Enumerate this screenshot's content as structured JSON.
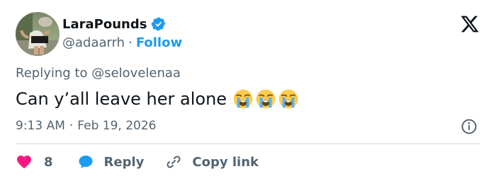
{
  "author": {
    "name": "LaraPounds",
    "handle": "@adaarrh",
    "separator": "·",
    "follow_label": "Follow",
    "verified": true
  },
  "reply_context": {
    "prefix": "Replying to",
    "mention": "@selovelenaa"
  },
  "tweet": {
    "text": "Can y’all leave her alone",
    "emojis": [
      "loudly-crying-face",
      "loudly-crying-face",
      "loudly-crying-face"
    ]
  },
  "timestamp": {
    "time": "9:13 AM",
    "separator": "·",
    "date": "Feb 19, 2026"
  },
  "actions": {
    "like_count": "8",
    "reply_label": "Reply",
    "copy_label": "Copy link"
  },
  "colors": {
    "text": "#0f1419",
    "secondary": "#536471",
    "accent": "#1d9bf0",
    "like": "#f91880",
    "divider": "#cfd9de"
  },
  "icons": {
    "logo": "x-logo-icon",
    "verified": "verified-badge-icon",
    "info": "info-icon",
    "like": "heart-icon",
    "reply": "speech-bubble-icon",
    "copy": "link-icon"
  }
}
